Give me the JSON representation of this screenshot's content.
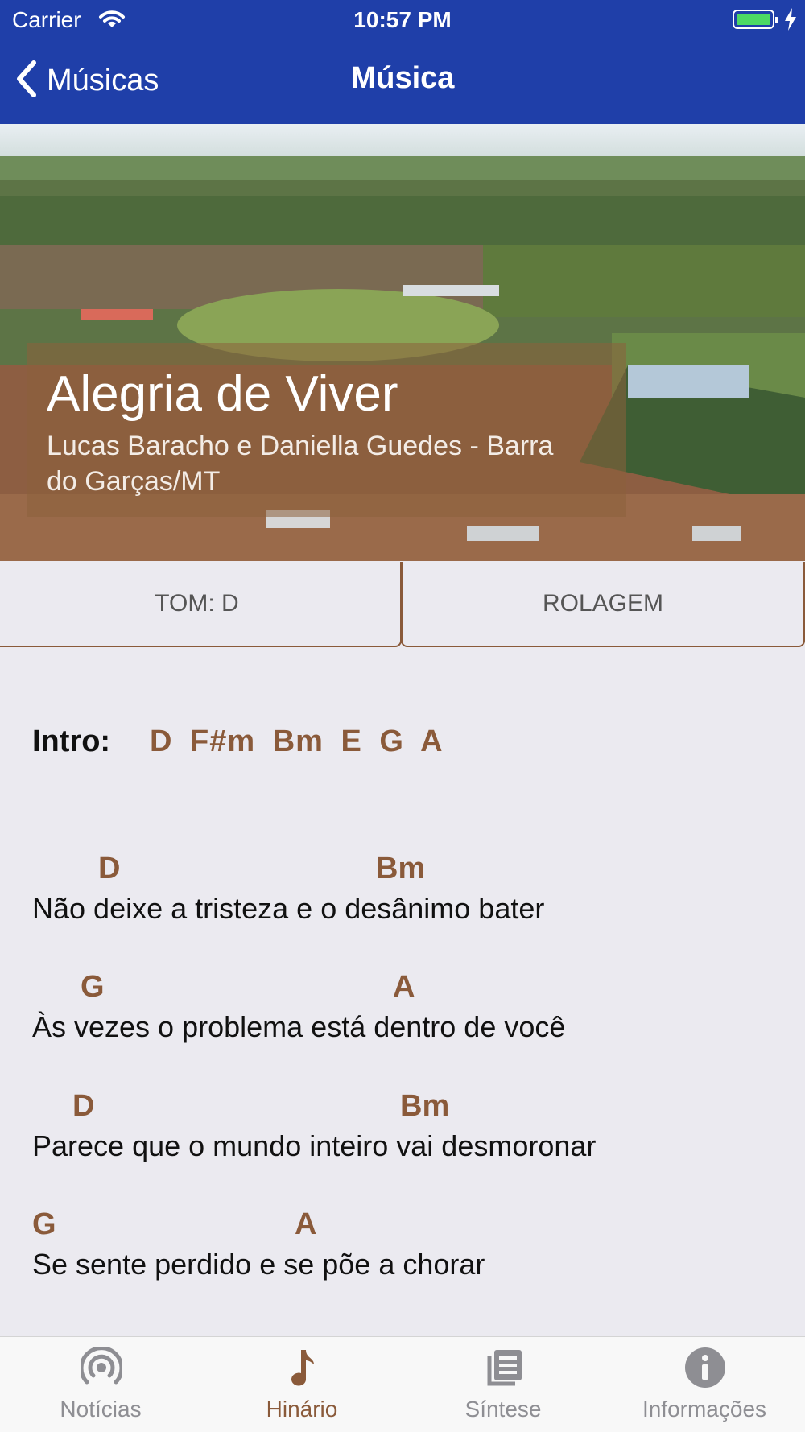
{
  "status_bar": {
    "carrier": "Carrier",
    "time": "10:57 PM"
  },
  "nav": {
    "back_label": "Músicas",
    "title": "Música"
  },
  "song": {
    "title": "Alegria de Viver",
    "author": "Lucas Baracho e Daniella Guedes - Barra do Garças/MT"
  },
  "controls": {
    "tom_label": "TOM: D",
    "rolagem_label": "ROLAGEM"
  },
  "intro": {
    "label": "Intro:",
    "chords": "D  F#m  Bm  E  G  A"
  },
  "verses": [
    {
      "chord1": "D",
      "chord2": "Bm",
      "lyric": "Não deixe a tristeza e o desânimo bater"
    },
    {
      "chord1": "G",
      "chord2": "A",
      "lyric": "Às vezes o problema está dentro de você"
    },
    {
      "chord1": "D",
      "chord2": "Bm",
      "lyric": "Parece que o mundo inteiro vai desmoronar"
    },
    {
      "chord1": "G",
      "chord2": "A",
      "lyric": "Se sente perdido e se põe a chorar"
    }
  ],
  "tabs": [
    {
      "label": "Notícias",
      "icon": "broadcast-icon"
    },
    {
      "label": "Hinário",
      "icon": "music-note-icon",
      "active": true
    },
    {
      "label": "Síntese",
      "icon": "document-icon"
    },
    {
      "label": "Informações",
      "icon": "info-icon"
    }
  ],
  "colors": {
    "nav_bar": "#1f3fa9",
    "accent": "#8a5a3a",
    "background": "#ebeaf0",
    "battery": "#4cd964"
  }
}
